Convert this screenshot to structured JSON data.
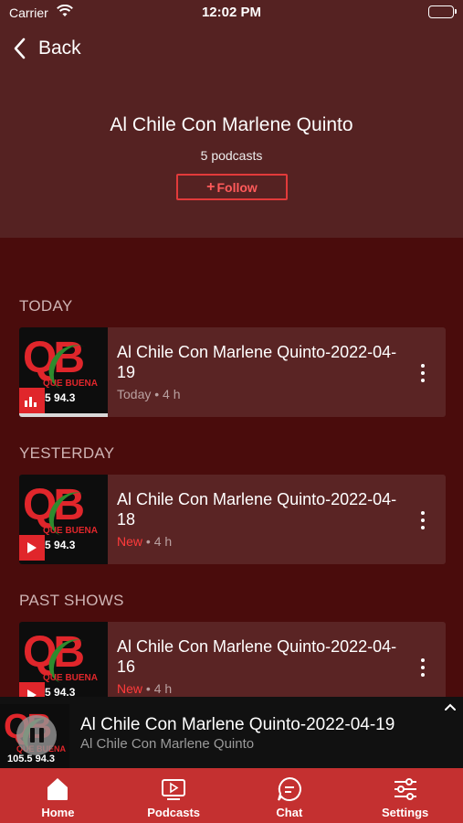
{
  "status_bar": {
    "carrier": "Carrier",
    "time": "12:02 PM"
  },
  "header": {
    "back_label": "Back",
    "title": "Al Chile Con Marlene Quinto",
    "count": "5 podcasts",
    "follow_label": "Follow"
  },
  "sections": [
    {
      "label": "TODAY",
      "episode": {
        "title": "Al Chile Con Marlene Quinto-2022-04-19",
        "status": "Today",
        "duration": "4 h",
        "badge": "equalizer-icon"
      }
    },
    {
      "label": "YESTERDAY",
      "episode": {
        "title": "Al Chile Con Marlene Quinto-2022-04-18",
        "status": "New",
        "duration": "4 h",
        "badge": "play-icon"
      }
    },
    {
      "label": "PAST SHOWS",
      "episode": {
        "title": "Al Chile Con Marlene Quinto-2022-04-16",
        "status": "New",
        "duration": "4 h",
        "badge": "play-icon"
      }
    }
  ],
  "thumbnail": {
    "logo": "QB",
    "name": "QUE BUENA",
    "freq": "105.5 94.3",
    "freq_short": "5.5 94.3"
  },
  "mini_player": {
    "title": "Al Chile Con Marlene Quinto-2022-04-19",
    "subtitle": "Al Chile Con Marlene Quinto"
  },
  "tabs": [
    {
      "label": "Home",
      "icon": "home-icon"
    },
    {
      "label": "Podcasts",
      "icon": "podcasts-icon"
    },
    {
      "label": "Chat",
      "icon": "chat-icon"
    },
    {
      "label": "Settings",
      "icon": "settings-icon"
    }
  ],
  "colors": {
    "accent": "#e0262b",
    "tabbar": "#c43030",
    "background": "#4a0c0c",
    "card": "#5a2424"
  }
}
